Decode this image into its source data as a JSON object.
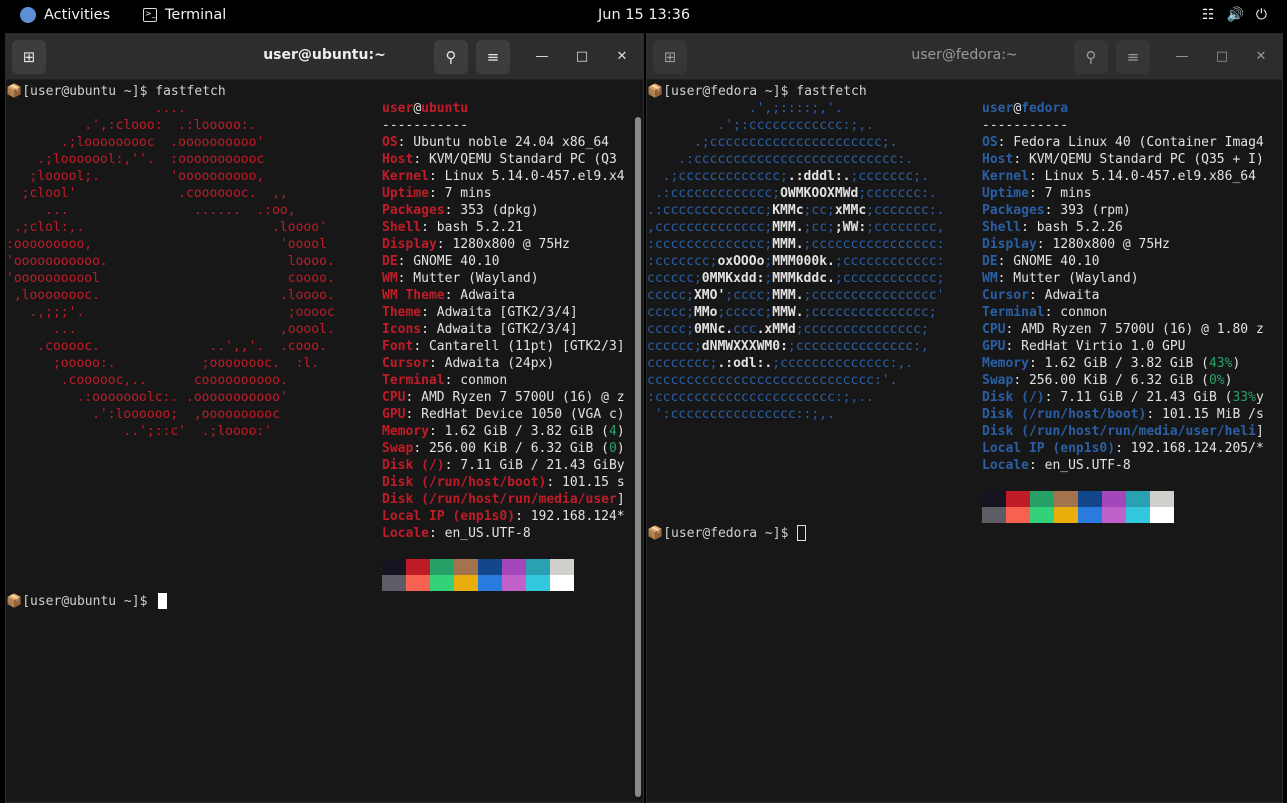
{
  "topbar": {
    "activities": "Activities",
    "app_name": "Terminal",
    "clock": "Jun 15  13:36",
    "tray_network_icon": "network-icon",
    "tray_volume_icon": "volume-icon",
    "tray_power_icon": "power-icon"
  },
  "left_window": {
    "title": "user@ubuntu:~",
    "prompt_cmd": "[user@ubuntu ~]$ fastfetch",
    "prompt_end": "[user@ubuntu ~]$ ",
    "logo": [
      "                   ....",
      "          .',:clooo:  .:looooo:.",
      "       .;looooooooc  .oooooooooo'",
      "    .;looooool:,''.  :ooooooooooc",
      "   ;looool;.         'oooooooooo,",
      "  ;clool'             .cooooooc.  ,,",
      "     ...                ......  .:oo,",
      " .;clol:,.                        .loooo'",
      ":ooooooooo,                        'ooool",
      "'ooooooooooo.                       loooo.",
      "'ooooooooool                        coooo.",
      " ,loooooooc.                       .loooo.",
      "   .,;;;'.                          ;ooooc",
      "      ...                          ,ooool.",
      "    .cooooc.              ..',,'.  .cooo.",
      "      ;ooooo:.           ;oooooooc.  :l.",
      "       .coooooc,..      coooooooooo.",
      "         .:ooooooolc:. .ooooooooooo'",
      "           .':loooooo;  ,oooooooooc",
      "               ..';::c'  .;loooo:'"
    ],
    "user": "user",
    "at": "@",
    "host": "ubuntu",
    "sep": "-----------",
    "info": [
      {
        "k": "OS",
        "v": ": Ubuntu noble 24.04 x86_64"
      },
      {
        "k": "Host",
        "v": ": KVM/QEMU Standard PC (Q3"
      },
      {
        "k": "Kernel",
        "v": ": Linux 5.14.0-457.el9.x4"
      },
      {
        "k": "Uptime",
        "v": ": 7 mins"
      },
      {
        "k": "Packages",
        "v": ": 353 (dpkg)"
      },
      {
        "k": "Shell",
        "v": ": bash 5.2.21"
      },
      {
        "k": "Display",
        "v": ": 1280x800 @ 75Hz"
      },
      {
        "k": "DE",
        "v": ": GNOME 40.10"
      },
      {
        "k": "WM",
        "v": ": Mutter (Wayland)"
      },
      {
        "k": "WM Theme",
        "v": ": Adwaita"
      },
      {
        "k": "Theme",
        "v": ": Adwaita [GTK2/3/4]"
      },
      {
        "k": "Icons",
        "v": ": Adwaita [GTK2/3/4]"
      },
      {
        "k": "Font",
        "v": ": Cantarell (11pt) [GTK2/3]"
      },
      {
        "k": "Cursor",
        "v": ": Adwaita (24px)"
      },
      {
        "k": "Terminal",
        "v": ": conmon"
      },
      {
        "k": "CPU",
        "v": ": AMD Ryzen 7 5700U (16) @ z"
      },
      {
        "k": "GPU",
        "v": ": RedHat Device 1050 (VGA c)"
      },
      {
        "k": "Memory",
        "v": ": 1.62 GiB / 3.82 GiB (",
        "p": "4",
        "t": ")"
      },
      {
        "k": "Swap",
        "v": ": 256.00 KiB / 6.32 GiB (",
        "p": "0",
        "t": ")"
      },
      {
        "k": "Disk (/)",
        "v": ": 7.11 GiB / 21.43 GiBy"
      },
      {
        "k": "Disk (/run/host/boot)",
        "v": ": 101.15 s"
      },
      {
        "k": "Disk (/run/host/run/media/user",
        "v": "]"
      },
      {
        "k": "Local IP (enp1s0)",
        "v": ": 192.168.124*"
      },
      {
        "k": "Locale",
        "v": ": en_US.UTF-8"
      }
    ]
  },
  "right_window": {
    "title": "user@fedora:~",
    "prompt_cmd": "[user@fedora ~]$ fastfetch",
    "prompt_end": "[user@fedora ~]$ ",
    "logo": [
      {
        "a": "             .',;::::;,'.",
        "b": ""
      },
      {
        "a": "         .';:cccccccccccc:;,.",
        "b": ""
      },
      {
        "a": "      .;cccccccccccccccccccccc;.",
        "b": ""
      },
      {
        "a": "    .:cccccccccccccccccccccccccc:.",
        "b": ""
      },
      {
        "a": "  .;ccccccccccccc;",
        "b": ".:dddl:.",
        "c": ";ccccccc;."
      },
      {
        "a": " .:ccccccccccccc;",
        "b": "OWMKOOXMWd",
        "c": ";ccccccc:."
      },
      {
        "a": ".:ccccccccccccc;",
        "b": "KMMc",
        "c": ";cc;",
        "d": "xMMc",
        "e": ";ccccccc:."
      },
      {
        "a": ",cccccccccccccc;",
        "b": "MMM.",
        "c": ";cc;",
        "d": ";WW:",
        "e": ";cccccccc,"
      },
      {
        "a": ":cccccccccccccc;",
        "b": "MMM.",
        "c": ";cccccccccccccccc:"
      },
      {
        "a": ":ccccccc;",
        "b": "oxOOOo",
        "c": ";",
        "d": "MMM000k.",
        "e": ";cccccccccccc:"
      },
      {
        "a": "cccccc;",
        "b": "0MMKxdd:",
        "c": ";",
        "d": "MMMkddc.",
        "e": ";cccccccccccc;"
      },
      {
        "a": "ccccc;",
        "b": "XMO'",
        "c": ";cccc;",
        "d": "MMM.",
        "e": ";cccccccccccccccc'"
      },
      {
        "a": "ccccc;",
        "b": "MMo",
        "c": ";ccccc;",
        "d": "MMW.",
        "e": ";ccccccccccccccc;"
      },
      {
        "a": "ccccc;",
        "b": "0MNc.",
        "c": "ccc",
        "d": ".xMMd",
        "e": ";ccccccccccccccc;"
      },
      {
        "a": "cccccc;",
        "b": "dNMWXXXWM0:",
        "c": ";ccccccccccccccc:,"
      },
      {
        "a": "cccccccc;",
        "b": ".:odl:.",
        "c": ";cccccccccccccc:,."
      },
      {
        "a": "ccccccccccccccccccccccccccccc:'.",
        "b": ""
      },
      {
        "a": ":ccccccccccccccccccccccc:;,..",
        "b": ""
      },
      {
        "a": " ':cccccccccccccccc::;,.",
        "b": ""
      }
    ],
    "user": "user",
    "at": "@",
    "host": "fedora",
    "sep": "-----------",
    "info": [
      {
        "k": "OS",
        "v": ": Fedora Linux 40 (Container Imag4"
      },
      {
        "k": "Host",
        "v": ": KVM/QEMU Standard PC (Q35 + I)"
      },
      {
        "k": "Kernel",
        "v": ": Linux 5.14.0-457.el9.x86_64"
      },
      {
        "k": "Uptime",
        "v": ": 7 mins"
      },
      {
        "k": "Packages",
        "v": ": 393 (rpm)"
      },
      {
        "k": "Shell",
        "v": ": bash 5.2.26"
      },
      {
        "k": "Display",
        "v": ": 1280x800 @ 75Hz"
      },
      {
        "k": "DE",
        "v": ": GNOME 40.10"
      },
      {
        "k": "WM",
        "v": ": Mutter (Wayland)"
      },
      {
        "k": "Cursor",
        "v": ": Adwaita"
      },
      {
        "k": "Terminal",
        "v": ": conmon"
      },
      {
        "k": "CPU",
        "v": ": AMD Ryzen 7 5700U (16) @ 1.80 z"
      },
      {
        "k": "GPU",
        "v": ": RedHat Virtio 1.0 GPU"
      },
      {
        "k": "Memory",
        "v": ": 1.62 GiB / 3.82 GiB (",
        "p": "43%",
        "t": ")"
      },
      {
        "k": "Swap",
        "v": ": 256.00 KiB / 6.32 GiB (",
        "p": "0%",
        "t": ")"
      },
      {
        "k": "Disk (/)",
        "v": ": 7.11 GiB / 21.43 GiB (",
        "p": "33%",
        "t": "y"
      },
      {
        "k": "Disk (/run/host/boot)",
        "v": ": 101.15 MiB /s"
      },
      {
        "k": "Disk (/run/host/run/media/user/heli",
        "v": "]"
      },
      {
        "k": "Local IP (enp1s0)",
        "v": ": 192.168.124.205/*"
      },
      {
        "k": "Locale",
        "v": ": en_US.UTF-8"
      }
    ]
  },
  "palette_top": [
    "#171421",
    "#c01c28",
    "#26a269",
    "#a2734c",
    "#12488b",
    "#a347ba",
    "#2aa1b3",
    "#d0cfcc"
  ],
  "palette_bottom": [
    "#5e5c64",
    "#f66151",
    "#33d17a",
    "#e9ad0c",
    "#2a7bde",
    "#c061cb",
    "#33c7de",
    "#ffffff"
  ],
  "colors": {
    "ubuntu_accent": "#c01c28",
    "fedora_accent": "#2a5fa5",
    "percent_green": "#26a269"
  },
  "icons": {
    "new_tab": "new-tab-icon",
    "search": "search-icon",
    "menu": "hamburger-menu-icon",
    "minimize": "minimize-icon",
    "maximize": "maximize-icon",
    "close": "close-icon",
    "prompt_box": "package-icon"
  }
}
